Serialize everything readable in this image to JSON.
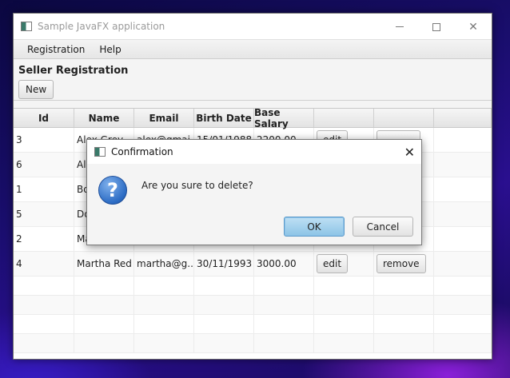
{
  "window": {
    "title": "Sample JavaFX application"
  },
  "menu": {
    "items": [
      {
        "label": "Registration"
      },
      {
        "label": "Help"
      }
    ]
  },
  "page": {
    "title": "Seller Registration",
    "new_label": "New"
  },
  "table": {
    "headers": [
      "Id",
      "Name",
      "Email",
      "Birth Date",
      "Base Salary",
      "",
      "",
      ""
    ],
    "rows": [
      {
        "id": "3",
        "name": "Alex Grey",
        "email": "alex@gmai",
        "birth": "15/01/1988",
        "salary": "2200.00",
        "edit": "edit",
        "remove": ""
      },
      {
        "id": "6",
        "name": "Ale",
        "email": "",
        "birth": "",
        "salary": "",
        "edit": "",
        "remove": ""
      },
      {
        "id": "1",
        "name": "Bo",
        "email": "",
        "birth": "",
        "salary": "",
        "edit": "",
        "remove": ""
      },
      {
        "id": "5",
        "name": "Do",
        "email": "",
        "birth": "",
        "salary": "",
        "edit": "",
        "remove": ""
      },
      {
        "id": "2",
        "name": "Ma",
        "email": "",
        "birth": "",
        "salary": "",
        "edit": "",
        "remove": ""
      },
      {
        "id": "4",
        "name": "Martha Red",
        "email": "martha@g...",
        "birth": "30/11/1993",
        "salary": "3000.00",
        "edit": "edit",
        "remove": "remove"
      }
    ]
  },
  "dialog": {
    "title": "Confirmation",
    "message": "Are you sure to delete?",
    "ok_label": "OK",
    "cancel_label": "Cancel"
  },
  "icons": {
    "app": "javafx-app-icon",
    "question": "question-icon",
    "question_glyph": "?"
  }
}
